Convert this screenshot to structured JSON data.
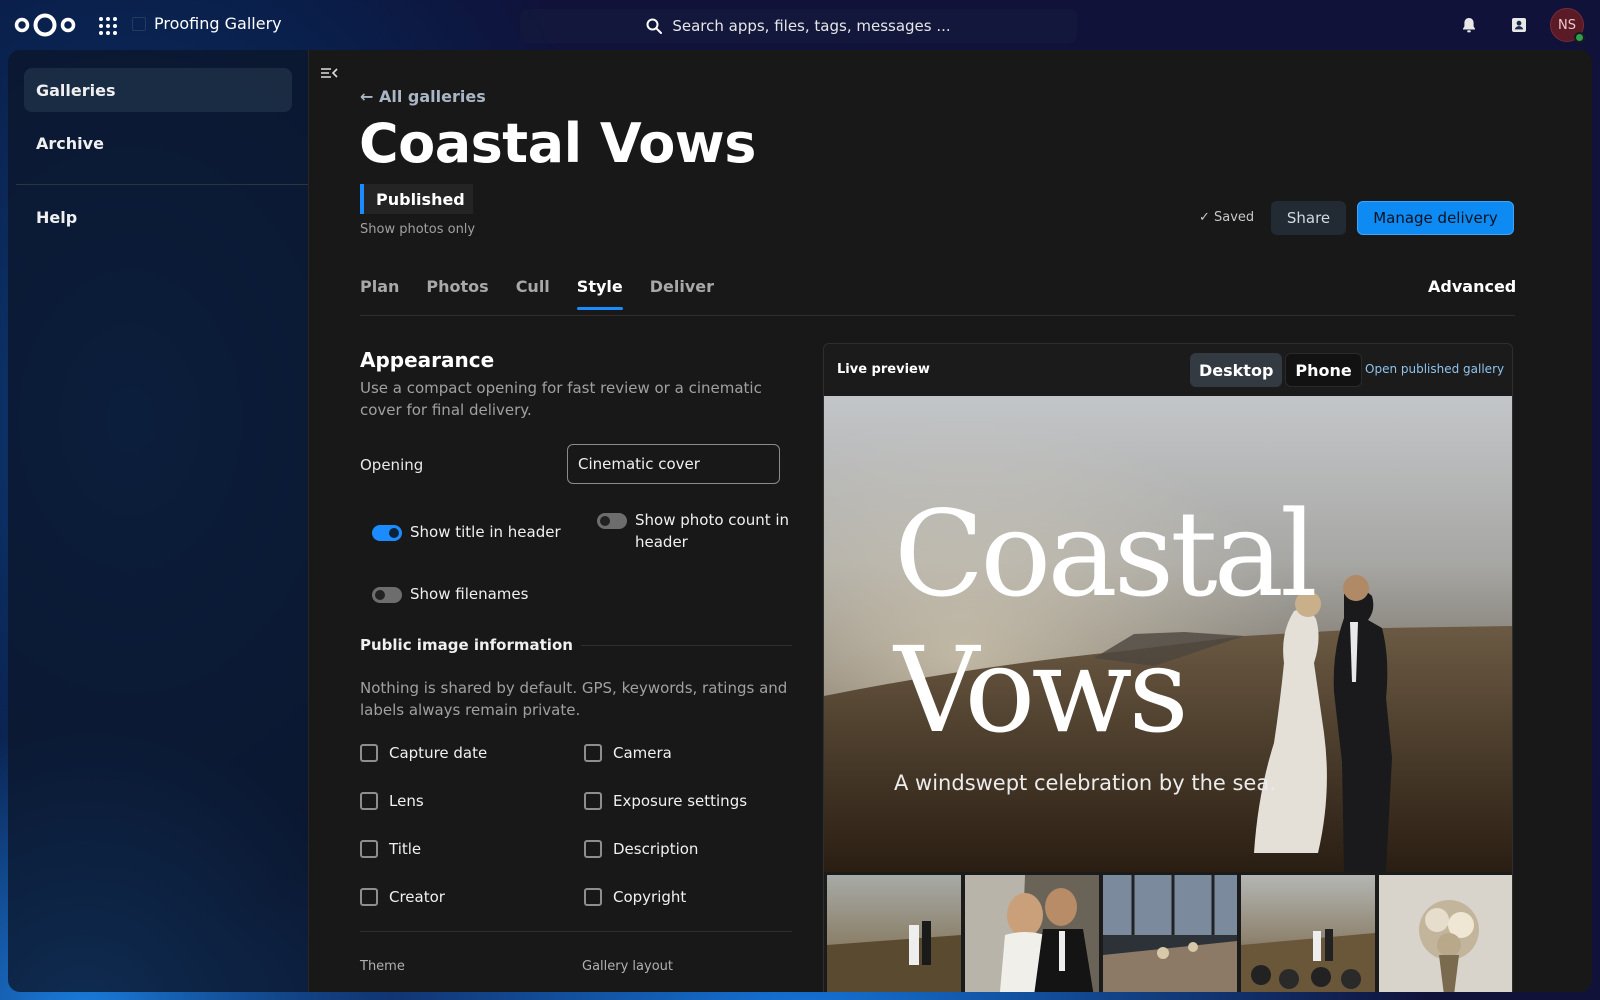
{
  "app": {
    "name": "Proofing Gallery",
    "search_placeholder": "Search apps, files, tags, messages ...",
    "avatar_initials": "NS",
    "accent": "#1a8cff"
  },
  "sidebar": {
    "items": [
      {
        "label": "Galleries",
        "active": true
      },
      {
        "label": "Archive",
        "active": false
      },
      {
        "label": "Help",
        "active": false
      }
    ]
  },
  "gallery": {
    "back_label": "← All galleries",
    "title": "Coastal Vows",
    "status": "Published",
    "view_mode": "Show photos only",
    "save_state": "✓ Saved",
    "share_label": "Share",
    "manage_label": "Manage delivery"
  },
  "tabs": {
    "items": [
      "Plan",
      "Photos",
      "Cull",
      "Style",
      "Deliver"
    ],
    "active": "Style",
    "advanced": "Advanced"
  },
  "appearance": {
    "title": "Appearance",
    "description": "Use a compact opening for fast review or a cinematic cover for final delivery.",
    "opening_label": "Opening",
    "opening_value": "Cinematic cover",
    "toggles": [
      {
        "label": "Show title in header",
        "on": true
      },
      {
        "label": "Show photo count in header",
        "on": false
      },
      {
        "label": "Show filenames",
        "on": false
      }
    ]
  },
  "public_info": {
    "title": "Public image information",
    "description": "Nothing is shared by default. GPS, keywords, ratings and labels always remain private.",
    "options": [
      {
        "label": "Capture date",
        "checked": false
      },
      {
        "label": "Camera",
        "checked": false
      },
      {
        "label": "Lens",
        "checked": false
      },
      {
        "label": "Exposure settings",
        "checked": false
      },
      {
        "label": "Title",
        "checked": false
      },
      {
        "label": "Description",
        "checked": false
      },
      {
        "label": "Creator",
        "checked": false
      },
      {
        "label": "Copyright",
        "checked": false
      }
    ]
  },
  "footer_labels": {
    "theme": "Theme",
    "gallery_layout": "Gallery layout"
  },
  "preview": {
    "label": "Live preview",
    "modes": [
      "Desktop",
      "Phone"
    ],
    "active_mode": "Desktop",
    "open_link": "Open published gallery",
    "hero_title_line1": "Coastal",
    "hero_title_line2": "Vows",
    "hero_subtitle": "A windswept celebration by the sea."
  }
}
